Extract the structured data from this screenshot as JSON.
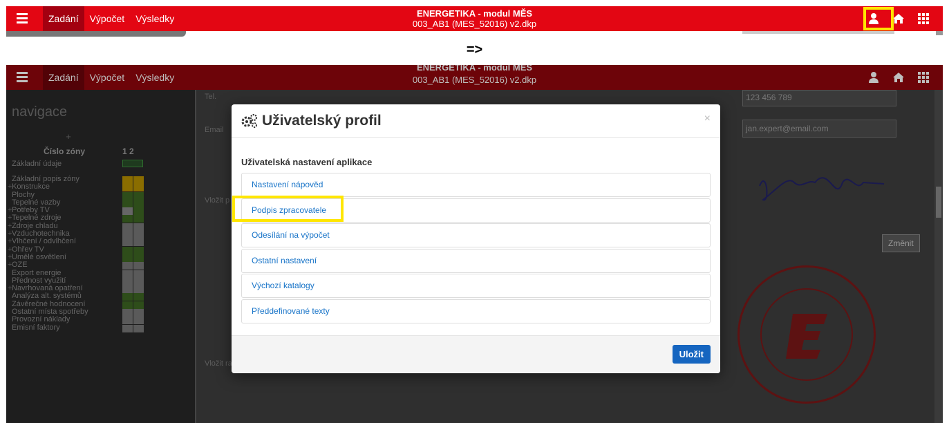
{
  "app": {
    "nav": [
      "Zadání",
      "Výpočet",
      "Výsledky"
    ],
    "title_line1": "ENERGETIKA - modul MĚS",
    "title_line2": "003_AB1 (MES_52016) v2.dkp"
  },
  "separator": "=>",
  "navpanel": {
    "heading": "navigace",
    "plus": "+",
    "zone_label": "Číslo zóny",
    "zone_nums": "1  2",
    "items": [
      {
        "p": "",
        "label": "Základní údaje"
      },
      {
        "p": "",
        "label": "Základní popis zóny"
      },
      {
        "p": "+",
        "label": "Konstrukce"
      },
      {
        "p": "",
        "label": "Plochy"
      },
      {
        "p": "",
        "label": "Tepelné vazby"
      },
      {
        "p": "+",
        "label": "Potřeby TV"
      },
      {
        "p": "+",
        "label": "Tepelné zdroje"
      },
      {
        "p": "+",
        "label": "Zdroje chladu"
      },
      {
        "p": "+",
        "label": "Vzduchotechnika"
      },
      {
        "p": "+",
        "label": "Vlhčení / odvlhčení"
      },
      {
        "p": "+",
        "label": "Ohřev TV"
      },
      {
        "p": "+",
        "label": "Umělé osvětlení"
      },
      {
        "p": "+",
        "label": "OZE"
      },
      {
        "p": "",
        "label": "Export energie"
      },
      {
        "p": "",
        "label": "Přednost využití"
      },
      {
        "p": "+",
        "label": "Navrhovaná opatření"
      },
      {
        "p": "",
        "label": "Analýza alt. systémů"
      },
      {
        "p": "",
        "label": "Závěrečné hodnocení"
      },
      {
        "p": "",
        "label": "Ostatní místa spotřeby"
      },
      {
        "p": "",
        "label": "Provozní náklady"
      },
      {
        "p": "",
        "label": "Emisní faktory"
      }
    ]
  },
  "form": {
    "tel_label": "Tel.",
    "tel_value": "123 456 789",
    "email_label": "Email",
    "email_value": "jan.expert@email.com",
    "vlozit_p": "Vložit p",
    "vlozit_r": "Vložit ra",
    "zmenit": "Změnit"
  },
  "modal": {
    "title": "Uživatelský profil",
    "close": "×",
    "subtitle": "Uživatelská nastavení aplikace",
    "items": [
      "Nastavení nápověd",
      "Podpis zpracovatele",
      "Odesílání na výpočet",
      "Ostatní nastavení",
      "Výchozí katalogy",
      "Předdefinované texty"
    ],
    "save": "Uložit"
  },
  "colors": {
    "accent": "#e30613",
    "highlight": "#ffe600",
    "link": "#1874c8",
    "save": "#1565c0"
  }
}
